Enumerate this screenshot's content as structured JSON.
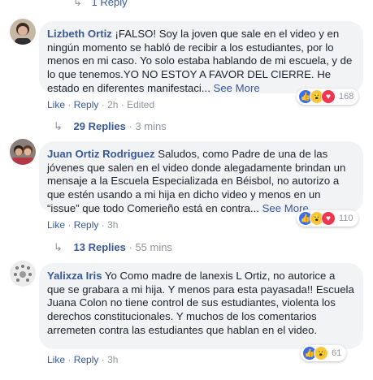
{
  "top_reply": {
    "label": "1 Reply"
  },
  "comments": [
    {
      "name": "Lizbeth Ortiz",
      "text": "¡FALSO! Soy la joven que sale en el video y en ningún momento se habló de recibir a los estudiantes, por lo menos en mi caso. Yo solo estaba hablando de mi escuela, y de lo que tenemos.YO NO ESTOY A FAVOR DEL CIERRE. He estado en diferentes manifestaci...",
      "see_more": "See More",
      "like": "Like",
      "reply": "Reply",
      "time": "2h",
      "edited": "Edited",
      "reaction_count": "168",
      "replies_label": "29 Replies",
      "replies_time": "3 mins",
      "reactions": [
        "like-icon",
        "wow-icon",
        "love-icon"
      ]
    },
    {
      "name": "Juan Ortiz Rodriguez",
      "text": "Saludos, como Padre de una de las jóvenes que salen en el video donde alegadamente brindan un mensaje a la Escuela Especializada en Béisbol, no autorizo a que estén usando a mi hija en dicho video y menos en un “issue” que todo Comerieño está en contra...",
      "see_more": "See More",
      "like": "Like",
      "reply": "Reply",
      "time": "3h",
      "reaction_count": "110",
      "replies_label": "13 Replies",
      "replies_time": "55 mins",
      "reactions": [
        "like-icon",
        "wow-icon",
        "love-icon"
      ]
    },
    {
      "name": "Yalixza Iris",
      "text": "Yo Como madre de lanexis L Ortiz, no autorice a que se grabara a mi hija. Y menos para esta payasada!! Escuela Juana Colon no tiene control de sus estudiantes, violenta los derechos constitucionales. Y muchos de los comentarios arremeten contra las estudiantes que hablan en el video.",
      "like": "Like",
      "reply": "Reply",
      "time": "3h",
      "reaction_count": "61",
      "reactions": [
        "like-icon",
        "wow-icon"
      ]
    }
  ],
  "colors": {
    "link": "#385898",
    "bubble": "#f2f3f5",
    "meta": "#90949c"
  }
}
